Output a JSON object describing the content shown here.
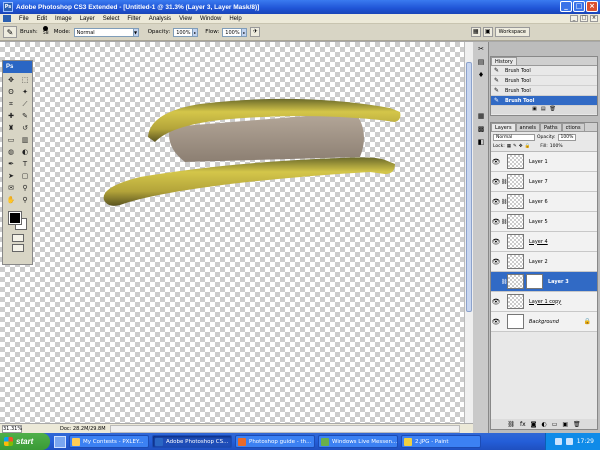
{
  "window": {
    "title": "Adobe Photoshop CS3 Extended - [Untitled-1 @ 31.3% (Layer 3, Layer Mask/8)]",
    "app_icon": "Ps"
  },
  "menu": [
    "File",
    "Edit",
    "Image",
    "Layer",
    "Select",
    "Filter",
    "Analysis",
    "View",
    "Window",
    "Help"
  ],
  "options": {
    "brush_label": "Brush:",
    "brush_size": "58",
    "mode_label": "Mode:",
    "mode_value": "Normal",
    "opacity_label": "Opacity:",
    "opacity_value": "100%",
    "flow_label": "Flow:",
    "flow_value": "100%",
    "workspace_label": "Workspace"
  },
  "toolbox": {
    "logo": "Ps"
  },
  "status": {
    "zoom": "31.31%",
    "doc": "Doc: 28.2M/29.8M"
  },
  "history": {
    "tab": "History",
    "items": [
      {
        "label": "Brush Tool",
        "selected": false
      },
      {
        "label": "Brush Tool",
        "selected": false
      },
      {
        "label": "Brush Tool",
        "selected": false
      },
      {
        "label": "Brush Tool",
        "selected": true
      }
    ]
  },
  "layers_panel": {
    "tabs": [
      "Layers",
      "annels",
      "Paths",
      "ctions"
    ],
    "blend": "Normal",
    "opacity_label": "Opacity:",
    "opacity_value": "100%",
    "lock_label": "Lock:",
    "fill_label": "Fill:",
    "fill_value": "100%",
    "layers": [
      {
        "name": "Layer 1",
        "visible": true,
        "selected": false
      },
      {
        "name": "Layer 7",
        "visible": true,
        "selected": false
      },
      {
        "name": "Layer 6",
        "visible": true,
        "selected": false
      },
      {
        "name": "Layer 5",
        "visible": true,
        "selected": false
      },
      {
        "name": "Layer 4",
        "visible": true,
        "selected": false
      },
      {
        "name": "Layer 2",
        "visible": true,
        "selected": false
      },
      {
        "name": "Layer 3",
        "visible": false,
        "selected": true
      },
      {
        "name": "Layer 1 copy",
        "visible": true,
        "selected": false
      },
      {
        "name": "Background",
        "visible": true,
        "selected": false
      }
    ]
  },
  "taskbar": {
    "start": "start",
    "items": [
      {
        "label": "My Contests - PXLEY...",
        "active": false
      },
      {
        "label": "Adobe Photoshop CS...",
        "active": true
      },
      {
        "label": "Photoshop guide - th...",
        "active": false
      },
      {
        "label": "Windows Live Messen...",
        "active": false
      },
      {
        "label": "2.JPG - Paint",
        "active": false
      }
    ],
    "clock": "17:29"
  },
  "colors": {
    "selection": "#316ac5",
    "title_bar": "#1f54d6",
    "taskbar": "#245ed8",
    "start": "#3a9a36"
  }
}
